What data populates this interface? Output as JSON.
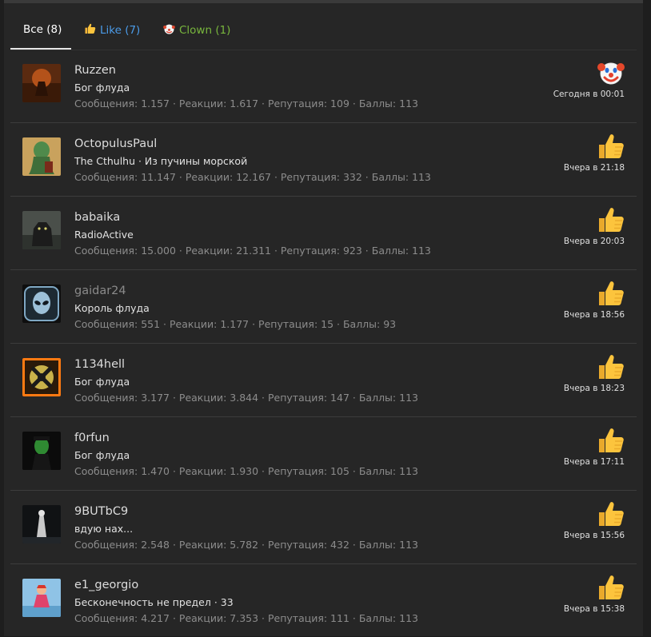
{
  "tabs": [
    {
      "label": "Все (8)"
    },
    {
      "label": "Like (7)"
    },
    {
      "label": "Clown (1)"
    }
  ],
  "colors": {
    "like_tab": "#4b9be8",
    "clown_tab": "#78b63d",
    "panel_bg": "#262626"
  },
  "reactions": [
    {
      "username": "Ruzzen",
      "title": "Бог флуда",
      "stats": "Сообщения: 1.157 · Реакции: 1.617 · Репутация: 109 · Баллы: 113",
      "reaction_icon": "clown-icon",
      "time": "Сегодня в 00:01"
    },
    {
      "username": "OctopulusPaul",
      "title": "The Cthulhu · Из пучины морской",
      "stats": "Сообщения: 11.147 · Реакции: 12.167 · Репутация: 332 · Баллы: 113",
      "reaction_icon": "thumbs-up-icon",
      "time": "Вчера в 21:18"
    },
    {
      "username": "babaika",
      "title": "RadioActive",
      "stats": "Сообщения: 15.000 · Реакции: 21.311 · Репутация: 923 · Баллы: 113",
      "reaction_icon": "thumbs-up-icon",
      "time": "Вчера в 20:03"
    },
    {
      "username": "gaidar24",
      "title": "Король флуда",
      "stats": "Сообщения: 551 · Реакции: 1.177 · Репутация: 15 · Баллы: 93",
      "reaction_icon": "thumbs-up-icon",
      "time": "Вчера в 18:56"
    },
    {
      "username": "1134hell",
      "title": "Бог флуда",
      "stats": "Сообщения: 3.177 · Реакции: 3.844 · Репутация: 147 · Баллы: 113",
      "reaction_icon": "thumbs-up-icon",
      "time": "Вчера в 18:23"
    },
    {
      "username": "f0rfun",
      "title": "Бог флуда",
      "stats": "Сообщения: 1.470 · Реакции: 1.930 · Репутация: 105 · Баллы: 113",
      "reaction_icon": "thumbs-up-icon",
      "time": "Вчера в 17:11"
    },
    {
      "username": "9BUTbC9",
      "title": "вдую нах...",
      "stats": "Сообщения: 2.548 · Реакции: 5.782 · Репутация: 432 · Баллы: 113",
      "reaction_icon": "thumbs-up-icon",
      "time": "Вчера в 15:56"
    },
    {
      "username": "e1_georgio",
      "title": "Бесконечность не предел · 33",
      "stats": "Сообщения: 4.217 · Реакции: 7.353 · Репутация: 111 · Баллы: 113",
      "reaction_icon": "thumbs-up-icon",
      "time": "Вчера в 15:38"
    }
  ]
}
